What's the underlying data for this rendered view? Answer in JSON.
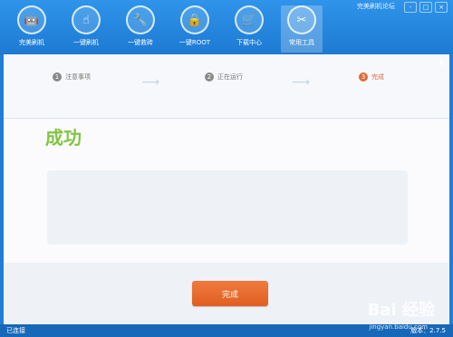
{
  "window": {
    "links": "完美刷机论坛",
    "controls": [
      "-",
      "□",
      "×"
    ]
  },
  "toolbar": [
    {
      "label": "完美刷机",
      "icon": "android-icon"
    },
    {
      "label": "一键刷机",
      "icon": "touch-icon"
    },
    {
      "label": "一键救砖",
      "icon": "repair-icon"
    },
    {
      "label": "一键ROOT",
      "icon": "lock-icon"
    },
    {
      "label": "下载中心",
      "icon": "cart-icon"
    },
    {
      "label": "常用工具",
      "icon": "tools-icon"
    }
  ],
  "steps": [
    {
      "num": "1",
      "label": "注意事项"
    },
    {
      "num": "2",
      "label": "正在运行"
    },
    {
      "num": "3",
      "label": "完成"
    }
  ],
  "main": {
    "status": "成功"
  },
  "actions": {
    "finish": "完成"
  },
  "footer": {
    "status": "已连接",
    "version": "版本：2.7.5"
  },
  "watermark": {
    "brand": "Bai 经验",
    "url": "jingyan.baidu.com"
  }
}
